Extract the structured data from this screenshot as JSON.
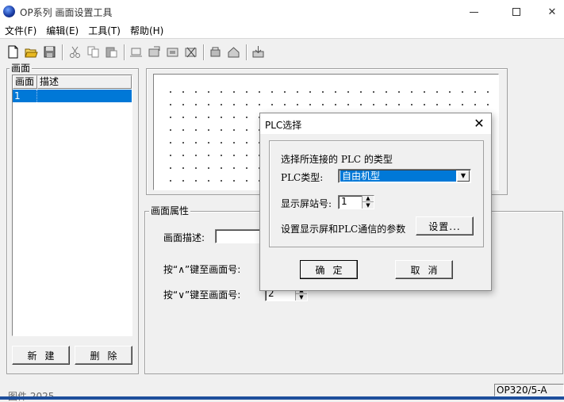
{
  "window": {
    "title": "OP系列 画面设置工具",
    "minimize": "—",
    "maximize": "□",
    "close": "✕"
  },
  "menu": [
    "文件(F)",
    "编辑(E)",
    "工具(T)",
    "帮助(H)"
  ],
  "toolbar": {
    "icons": [
      "new-file-icon",
      "open-folder-icon",
      "save-icon",
      "cut-icon",
      "copy-icon",
      "paste-icon",
      "screen-edit-icon",
      "screen-export-icon",
      "screen-import-icon",
      "delete-screen-icon",
      "plc-settings-icon",
      "home-icon",
      "download-icon"
    ]
  },
  "screens_panel": {
    "title": "画面",
    "columns": [
      "画面",
      "描述"
    ],
    "rows": [
      {
        "id": "1",
        "desc": ""
      }
    ],
    "new_button": "新建",
    "delete_button": "删除"
  },
  "properties": {
    "title": "画面属性",
    "desc_label": "画面描述:",
    "desc_value": "",
    "up_label": "按“∧”键至画面号:",
    "down_label": "按“∨”键至画面号:",
    "down_value": "2"
  },
  "status": {
    "model": "OP320/5-A",
    "taskbar_text": "图件 2025"
  },
  "dialog": {
    "title": "PLC选择",
    "group_title": "选择所连接的 PLC 的类型",
    "plc_type_label": "PLC类型:",
    "plc_type_value": "自由机型",
    "station_label": "显示屏站号:",
    "station_value": "1",
    "comm_label": "设置显示屏和PLC通信的参数",
    "settings_button": "设置...",
    "ok_button": "确定",
    "cancel_button": "取消"
  },
  "colors": {
    "selection": "#0078d7",
    "window_bg": "#f0f0f0"
  }
}
